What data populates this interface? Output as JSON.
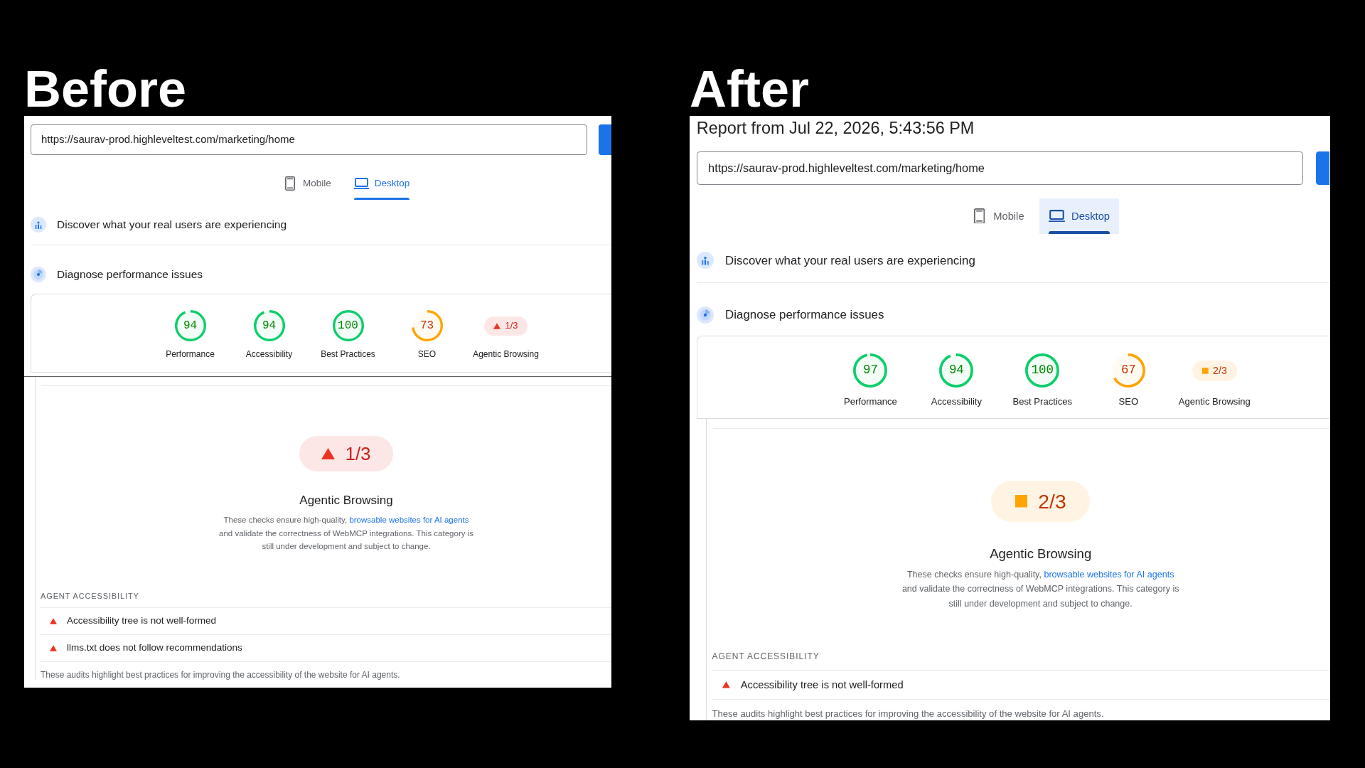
{
  "panels": [
    {
      "heading": "Before",
      "url": "https://saurav-prod.highleveltest.com/marketing/home",
      "tabs": [
        {
          "label": "Mobile",
          "kind": "phone",
          "selected": false,
          "hovered": false
        },
        {
          "label": "Desktop",
          "kind": "laptop",
          "selected": true,
          "hovered": false
        }
      ],
      "discover_row": {
        "title": "Discover what your real users are experiencing"
      },
      "diagnose_row": {
        "title": "Diagnose performance issues"
      },
      "scores": [
        {
          "label": "Performance",
          "kind": "gauge",
          "value": "94",
          "level": 0.94,
          "color": "#0cce6b"
        },
        {
          "label": "Accessibility",
          "kind": "gauge",
          "value": "94",
          "level": 0.94,
          "color": "#0cce6b"
        },
        {
          "label": "Best Practices",
          "kind": "gauge",
          "value": "100",
          "level": 1,
          "color": "#0cce6b"
        },
        {
          "label": "SEO",
          "kind": "gauge",
          "value": "73",
          "level": 0.73,
          "color": "#ffa400"
        },
        {
          "label": "Agentic Browsing",
          "kind": "fraction",
          "value": "1/3",
          "color": "#eb3323"
        }
      ],
      "category": {
        "score": "1/3",
        "color": "#eb3323",
        "title": "Agentic Browsing",
        "description_start": "These checks ensure high-quality,",
        "link": "browsable websites for AI agents",
        "description_end": "and validate the correctness of WebMCP integrations. This category is still under development and subject to change."
      },
      "audit_group": {
        "title": "AGENT ACCESSIBILITY",
        "audits": [
          {
            "title": "Accessibility tree is not well-formed",
            "color": "#eb3323"
          },
          {
            "title": "llms.txt does not follow recommendations",
            "color": "#eb3323"
          }
        ],
        "footer": "These audits highlight best practices for improving the accessibility of the website for AI agents."
      }
    },
    {
      "heading": "After",
      "report_title": "Report from Jul 22, 2026, 5:43:56 PM",
      "url": "https://saurav-prod.highleveltest.com/marketing/home",
      "tabs": [
        {
          "label": "Mobile",
          "kind": "phone",
          "selected": false,
          "hovered": false
        },
        {
          "label": "Desktop",
          "kind": "laptop",
          "selected": true,
          "hovered": true
        }
      ],
      "discover_row": {
        "title": "Discover what your real users are experiencing"
      },
      "diagnose_row": {
        "title": "Diagnose performance issues"
      },
      "scores": [
        {
          "label": "Performance",
          "kind": "gauge",
          "value": "97",
          "level": 0.97,
          "color": "#0cce6b"
        },
        {
          "label": "Accessibility",
          "kind": "gauge",
          "value": "94",
          "level": 0.94,
          "color": "#0cce6b"
        },
        {
          "label": "Best Practices",
          "kind": "gauge",
          "value": "100",
          "level": 1,
          "color": "#0cce6b"
        },
        {
          "label": "SEO",
          "kind": "gauge",
          "value": "67",
          "level": 0.67,
          "color": "#ffa400"
        },
        {
          "label": "Agentic Browsing",
          "kind": "fraction",
          "value": "2/3",
          "color": "#ffa400"
        }
      ],
      "category": {
        "score": "2/3",
        "color": "#ffa400",
        "title": "Agentic Browsing",
        "description_start": "These checks ensure high-quality,",
        "link": "browsable websites for AI agents",
        "description_end": "and validate the correctness of WebMCP integrations. This category is still under development and subject to change."
      },
      "audit_group": {
        "title": "AGENT ACCESSIBILITY",
        "audits": [
          {
            "title": "Accessibility tree is not well-formed",
            "color": "#eb3323"
          }
        ],
        "footer": "These audits highlight best practices for improving the accessibility of the website for AI agents."
      }
    }
  ]
}
